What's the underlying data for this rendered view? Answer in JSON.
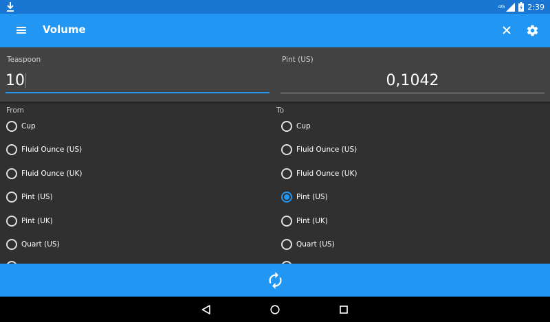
{
  "status_bar": {
    "time": "2:39",
    "network": "4G",
    "icons": [
      "download-icon",
      "signal-icon",
      "battery-icon"
    ]
  },
  "app_bar": {
    "title": "Volume",
    "icons": [
      "menu-icon",
      "close-icon",
      "gear-icon"
    ]
  },
  "input": {
    "from_unit": "Teaspoon",
    "from_value": "10",
    "to_unit": "Pint (US)",
    "to_value": "0,1042"
  },
  "from_list": {
    "header": "From",
    "selected": "",
    "options": [
      "Cup",
      "Fluid Ounce (US)",
      "Fluid Ounce (UK)",
      "Pint (US)",
      "Pint (UK)",
      "Quart (US)"
    ]
  },
  "to_list": {
    "header": "To",
    "selected": "Pint (US)",
    "options": [
      "Cup",
      "Fluid Ounce (US)",
      "Fluid Ounce (UK)",
      "Pint (US)",
      "Pint (UK)",
      "Quart (US)"
    ]
  },
  "swap_bar": {
    "icon": "swap-icon"
  },
  "nav_bar": {
    "icons": [
      "back-icon",
      "home-icon",
      "recent-apps-icon"
    ]
  },
  "colors": {
    "primary": "#2196f3",
    "primary_dark": "#1976d2",
    "background": "#303030",
    "input_panel": "#424242"
  }
}
